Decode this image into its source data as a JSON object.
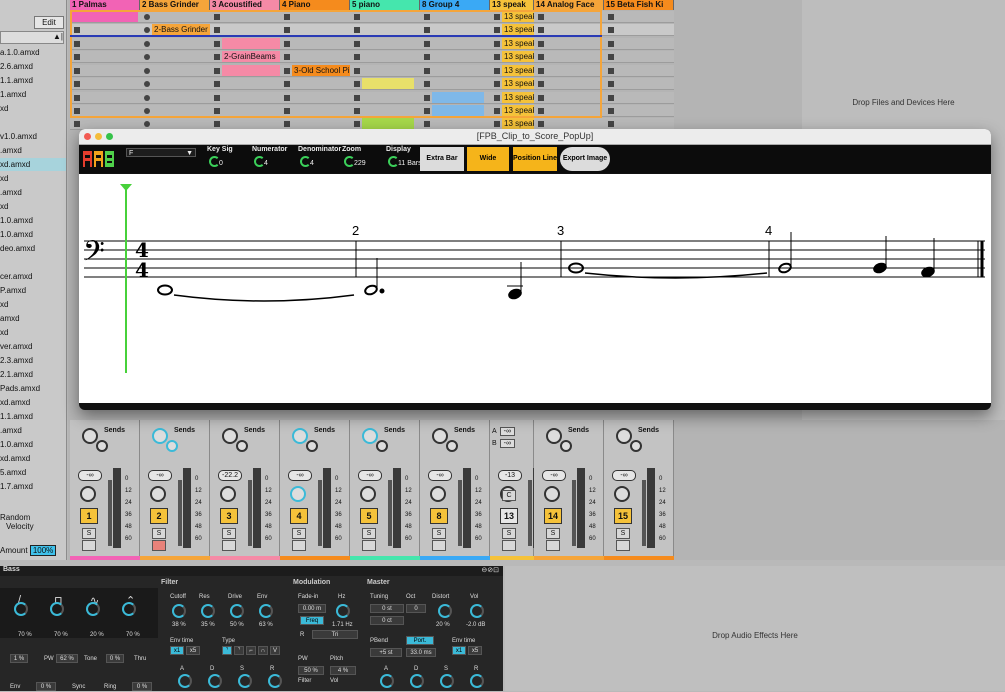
{
  "browser": {
    "edit_label": "Edit",
    "files": [
      "a.1.0.amxd",
      "2.6.amxd",
      "1.1.amxd",
      "1.amxd",
      "xd",
      "",
      "v1.0.amxd",
      ".amxd",
      "xd.amxd",
      "xd",
      ".amxd",
      "xd",
      "1.0.amxd",
      "1.0.amxd",
      "deo.amxd",
      "",
      "cer.amxd",
      "P.amxd",
      "xd",
      "amxd",
      "xd",
      "ver.amxd",
      "2.3.amxd",
      "2.1.amxd",
      "Pads.amxd",
      "xd.amxd",
      "1.1.amxd",
      ".amxd",
      "1.0.amxd",
      "xd.amxd",
      "5.amxd",
      "1.7.amxd"
    ],
    "selected_index": 8,
    "random_label": "Random",
    "velocity_label": "Velocity",
    "amount_label": "Amount",
    "amount_value": "100%"
  },
  "tracks": [
    {
      "name": "1 Palmas",
      "color": "#f263b5"
    },
    {
      "name": "2 Bass Grinder",
      "color": "#f5a53a"
    },
    {
      "name": "3 Acoustified",
      "color": "#f58aa6"
    },
    {
      "name": "4 Piano",
      "color": "#f58b1d"
    },
    {
      "name": "5 piano",
      "color": "#45e6ad"
    },
    {
      "name": "8 Group 4",
      "color": "#3aa9f5"
    },
    {
      "name": "13 speak",
      "color": "#f5c23a"
    },
    {
      "name": "14 Analog Face",
      "color": "#f5a53a"
    },
    {
      "name": "15 Beta Fish Ki",
      "color": "#f58b1d"
    }
  ],
  "clips": {
    "bass_grinder": "2-Bass Grinder",
    "grainbeams": "2-GrainBeams",
    "old_school": "3-Old School Pi",
    "speak": "13 speak"
  },
  "drop_files_text": "Drop Files and Devices Here",
  "drop_effects_text": "Drop Audio Effects Here",
  "mixer": {
    "sends_label": "Sends",
    "strips": [
      {
        "num": "1",
        "vol": "-∞"
      },
      {
        "num": "2",
        "vol": "-∞"
      },
      {
        "num": "3",
        "vol": "-22.2"
      },
      {
        "num": "4",
        "vol": "-∞"
      },
      {
        "num": "5",
        "vol": "-∞"
      },
      {
        "num": "8",
        "vol": "-∞"
      },
      {
        "num": "13",
        "vol": "-13"
      },
      {
        "num": "14",
        "vol": "-∞"
      },
      {
        "num": "15",
        "vol": "-∞"
      }
    ],
    "scale": [
      "0",
      "12",
      "24",
      "36",
      "48",
      "60"
    ],
    "solo_label": "S",
    "send_a_label": "A",
    "send_b_label": "B",
    "return_a_value": "-∞",
    "return_b_value": "-∞",
    "speak_mode_label": "C"
  },
  "popup": {
    "title": "[FPB_Clip_to_Score_PopUp]",
    "clef_select": "F",
    "controls": [
      {
        "label": "Key Sig",
        "value": "0"
      },
      {
        "label": "Numerator",
        "value": "4"
      },
      {
        "label": "Denominator",
        "value": "4"
      },
      {
        "label": "Zoom",
        "value": "229"
      },
      {
        "label": "Display",
        "value": "11 Bars"
      }
    ],
    "buttons": [
      "Extra Bar",
      "Wide",
      "Position Line",
      "Export Image"
    ],
    "score": {
      "time_sig_top": "4",
      "time_sig_bottom": "4",
      "measure_numbers": [
        "2",
        "3",
        "4"
      ]
    }
  },
  "device": {
    "title": "Bass",
    "sections": [
      "Filter",
      "Modulation",
      "Master"
    ],
    "osc_values": [
      "70 %",
      "70 %",
      "20 %",
      "70 %"
    ],
    "filter_labels": [
      "Cutoff",
      "Res",
      "Drive",
      "Env"
    ],
    "filter_values": [
      "38 %",
      "35 %",
      "50 %",
      "63 %"
    ],
    "env_time_label": "Env time",
    "env_time_opts": [
      "x1",
      "x5"
    ],
    "type_label": "Type",
    "fade_in_label": "Fade-in",
    "fade_in_value": "0.00 m",
    "hz_label": "Hz",
    "freq_label": "Freq",
    "freq_value": "1.71 Hz",
    "r_label": "R",
    "tri_label": "Tri",
    "tuning_label": "Tuning",
    "oct_label": "Oct",
    "distort_label": "Distort",
    "vol_label": "Vol",
    "tuning_value": "0 st",
    "oct_value": "0",
    "ct_value": "0 ct",
    "distort_value": "20 %",
    "vol_value": "-2.0 dB",
    "pbend_label": "PBend",
    "port_label": "Port.",
    "pbend_value": "+5 st",
    "port_value": "33.0 ms",
    "pw_label": "PW",
    "pw_value": "62 %",
    "tone_label": "Tone",
    "tone_value": "0 %",
    "thru_label": "Thru",
    "one_pct": "1 %",
    "mod_pw_label": "PW",
    "mod_pw_value": "50 %",
    "pitch_label": "Pitch",
    "pitch_value": "4 %",
    "filter2_label": "Filter",
    "vol2_label": "Vol",
    "adsr": [
      "A",
      "D",
      "S",
      "R"
    ],
    "env_label": "Env",
    "env_value": "0 %",
    "sync_label": "Sync",
    "ring_label": "Ring",
    "ring_value": "0 %"
  }
}
